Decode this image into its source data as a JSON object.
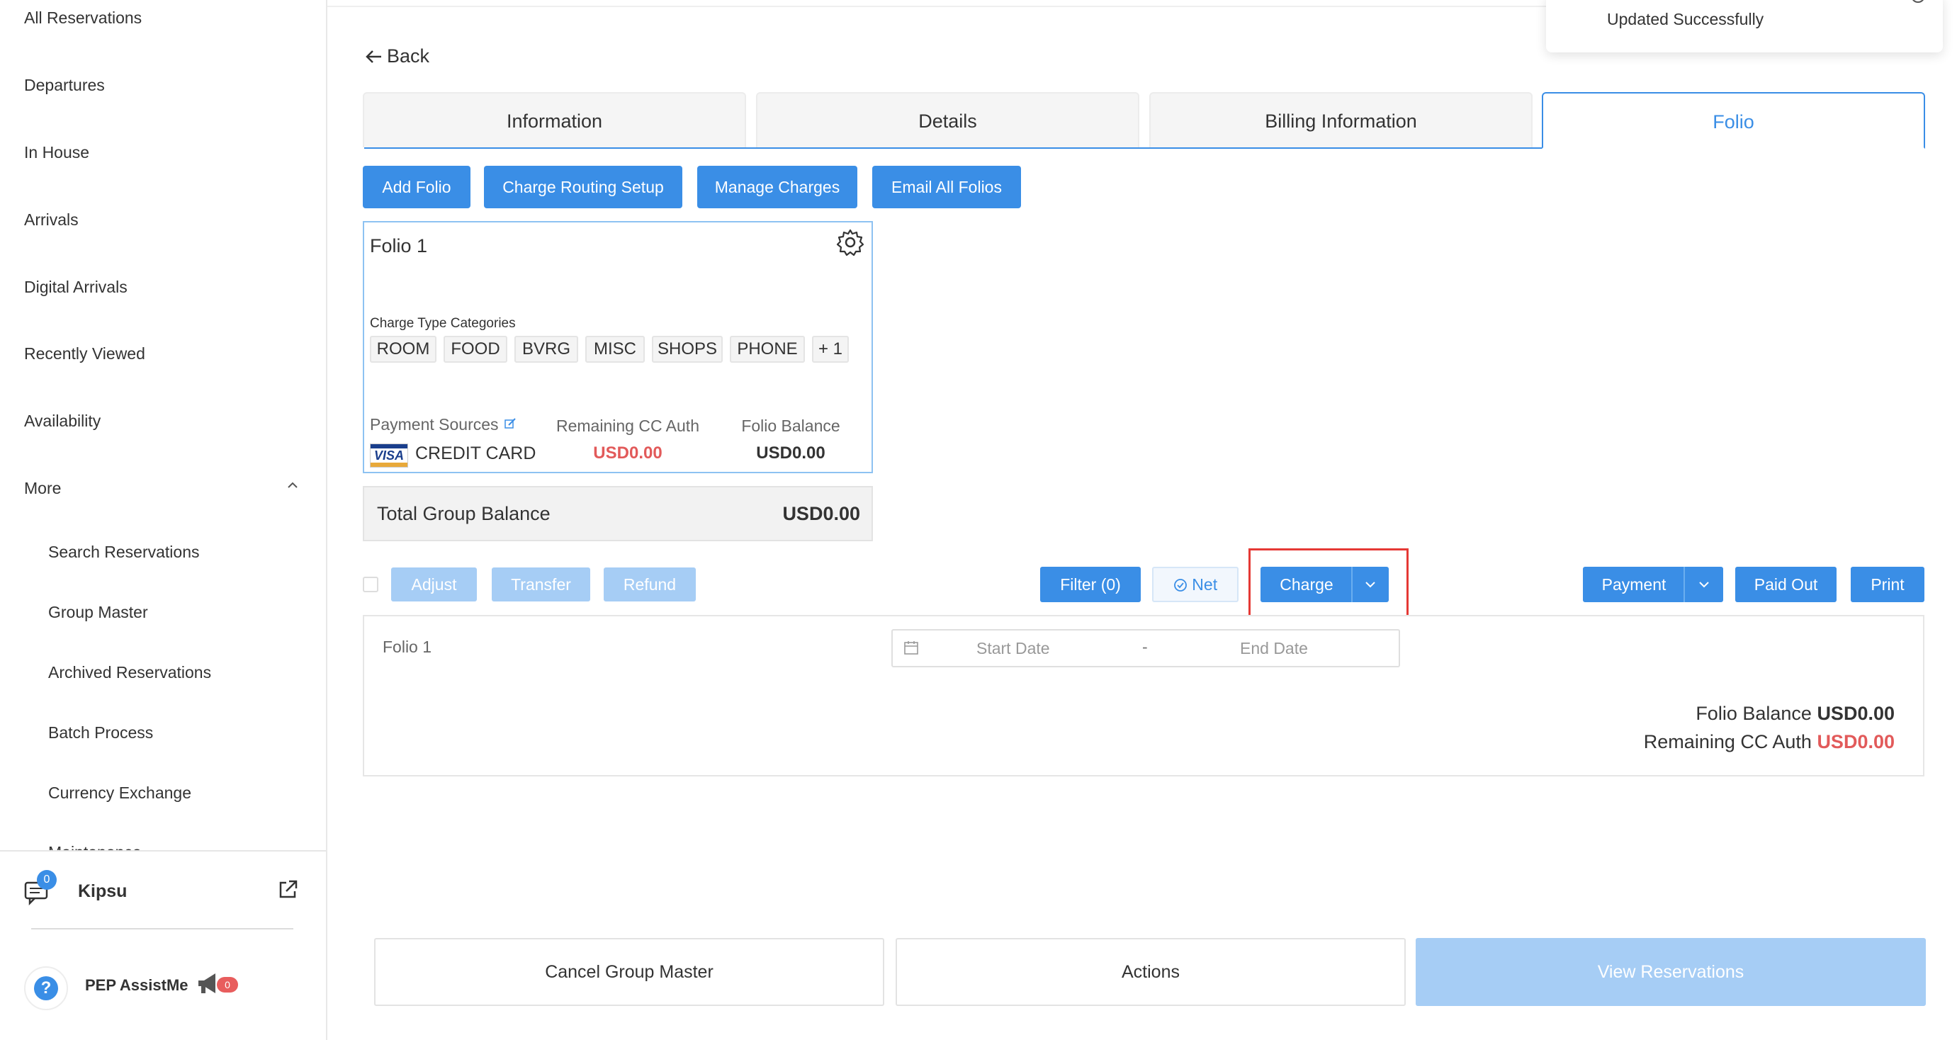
{
  "sidebar": {
    "items": [
      {
        "label": "All Reservations"
      },
      {
        "label": "Departures"
      },
      {
        "label": "In House"
      },
      {
        "label": "Arrivals"
      },
      {
        "label": "Digital Arrivals"
      },
      {
        "label": "Recently Viewed"
      },
      {
        "label": "Availability"
      },
      {
        "label": "More"
      }
    ],
    "sub_items": [
      {
        "label": "Search Reservations"
      },
      {
        "label": "Group Master"
      },
      {
        "label": "Archived Reservations"
      },
      {
        "label": "Batch Process"
      },
      {
        "label": "Currency Exchange"
      },
      {
        "label": "Maintenance"
      }
    ],
    "kipsu": {
      "label": "Kipsu",
      "badge": "0"
    },
    "assist": {
      "label": "PEP AssistMe",
      "badge": "0",
      "help_glyph": "?"
    }
  },
  "toast": {
    "message": "Updated Successfully"
  },
  "header": {
    "back_label": "Back"
  },
  "tabs": [
    {
      "label": "Information"
    },
    {
      "label": "Details"
    },
    {
      "label": "Billing Information"
    },
    {
      "label": "Folio",
      "active": true
    }
  ],
  "toolbar": {
    "add_folio": "Add Folio",
    "charge_routing": "Charge Routing Setup",
    "manage_charges": "Manage Charges",
    "email_all": "Email All Folios"
  },
  "folio_card": {
    "title": "Folio 1",
    "categories_label": "Charge Type Categories",
    "categories": [
      "ROOM",
      "FOOD",
      "BVRG",
      "MISC",
      "SHOPS",
      "PHONE",
      "+ 1"
    ],
    "payment_sources_label": "Payment Sources",
    "card_brand": "VISA",
    "card_type": "CREDIT CARD",
    "remaining_cc_label": "Remaining CC Auth",
    "remaining_cc_value": "USD0.00",
    "folio_balance_label": "Folio Balance",
    "folio_balance_value": "USD0.00"
  },
  "total_group": {
    "label": "Total Group Balance",
    "value": "USD0.00"
  },
  "actions": {
    "adjust": "Adjust",
    "transfer": "Transfer",
    "refund": "Refund",
    "filter": "Filter (0)",
    "net": "Net",
    "charge": "Charge",
    "payment": "Payment",
    "paid_out": "Paid Out",
    "print": "Print"
  },
  "panel": {
    "folio_label": "Folio 1",
    "start_date_placeholder": "Start Date",
    "date_separator": "-",
    "end_date_placeholder": "End Date",
    "folio_balance_label": "Folio Balance",
    "folio_balance_value": "USD0.00",
    "remaining_cc_label": "Remaining CC Auth",
    "remaining_cc_value": "USD0.00"
  },
  "footer": {
    "cancel_group": "Cancel Group Master",
    "actions": "Actions",
    "view_reservations": "View Reservations"
  },
  "colors": {
    "accent": "#3a8ee6",
    "danger": "#e25a5a",
    "highlight": "#e53935"
  }
}
